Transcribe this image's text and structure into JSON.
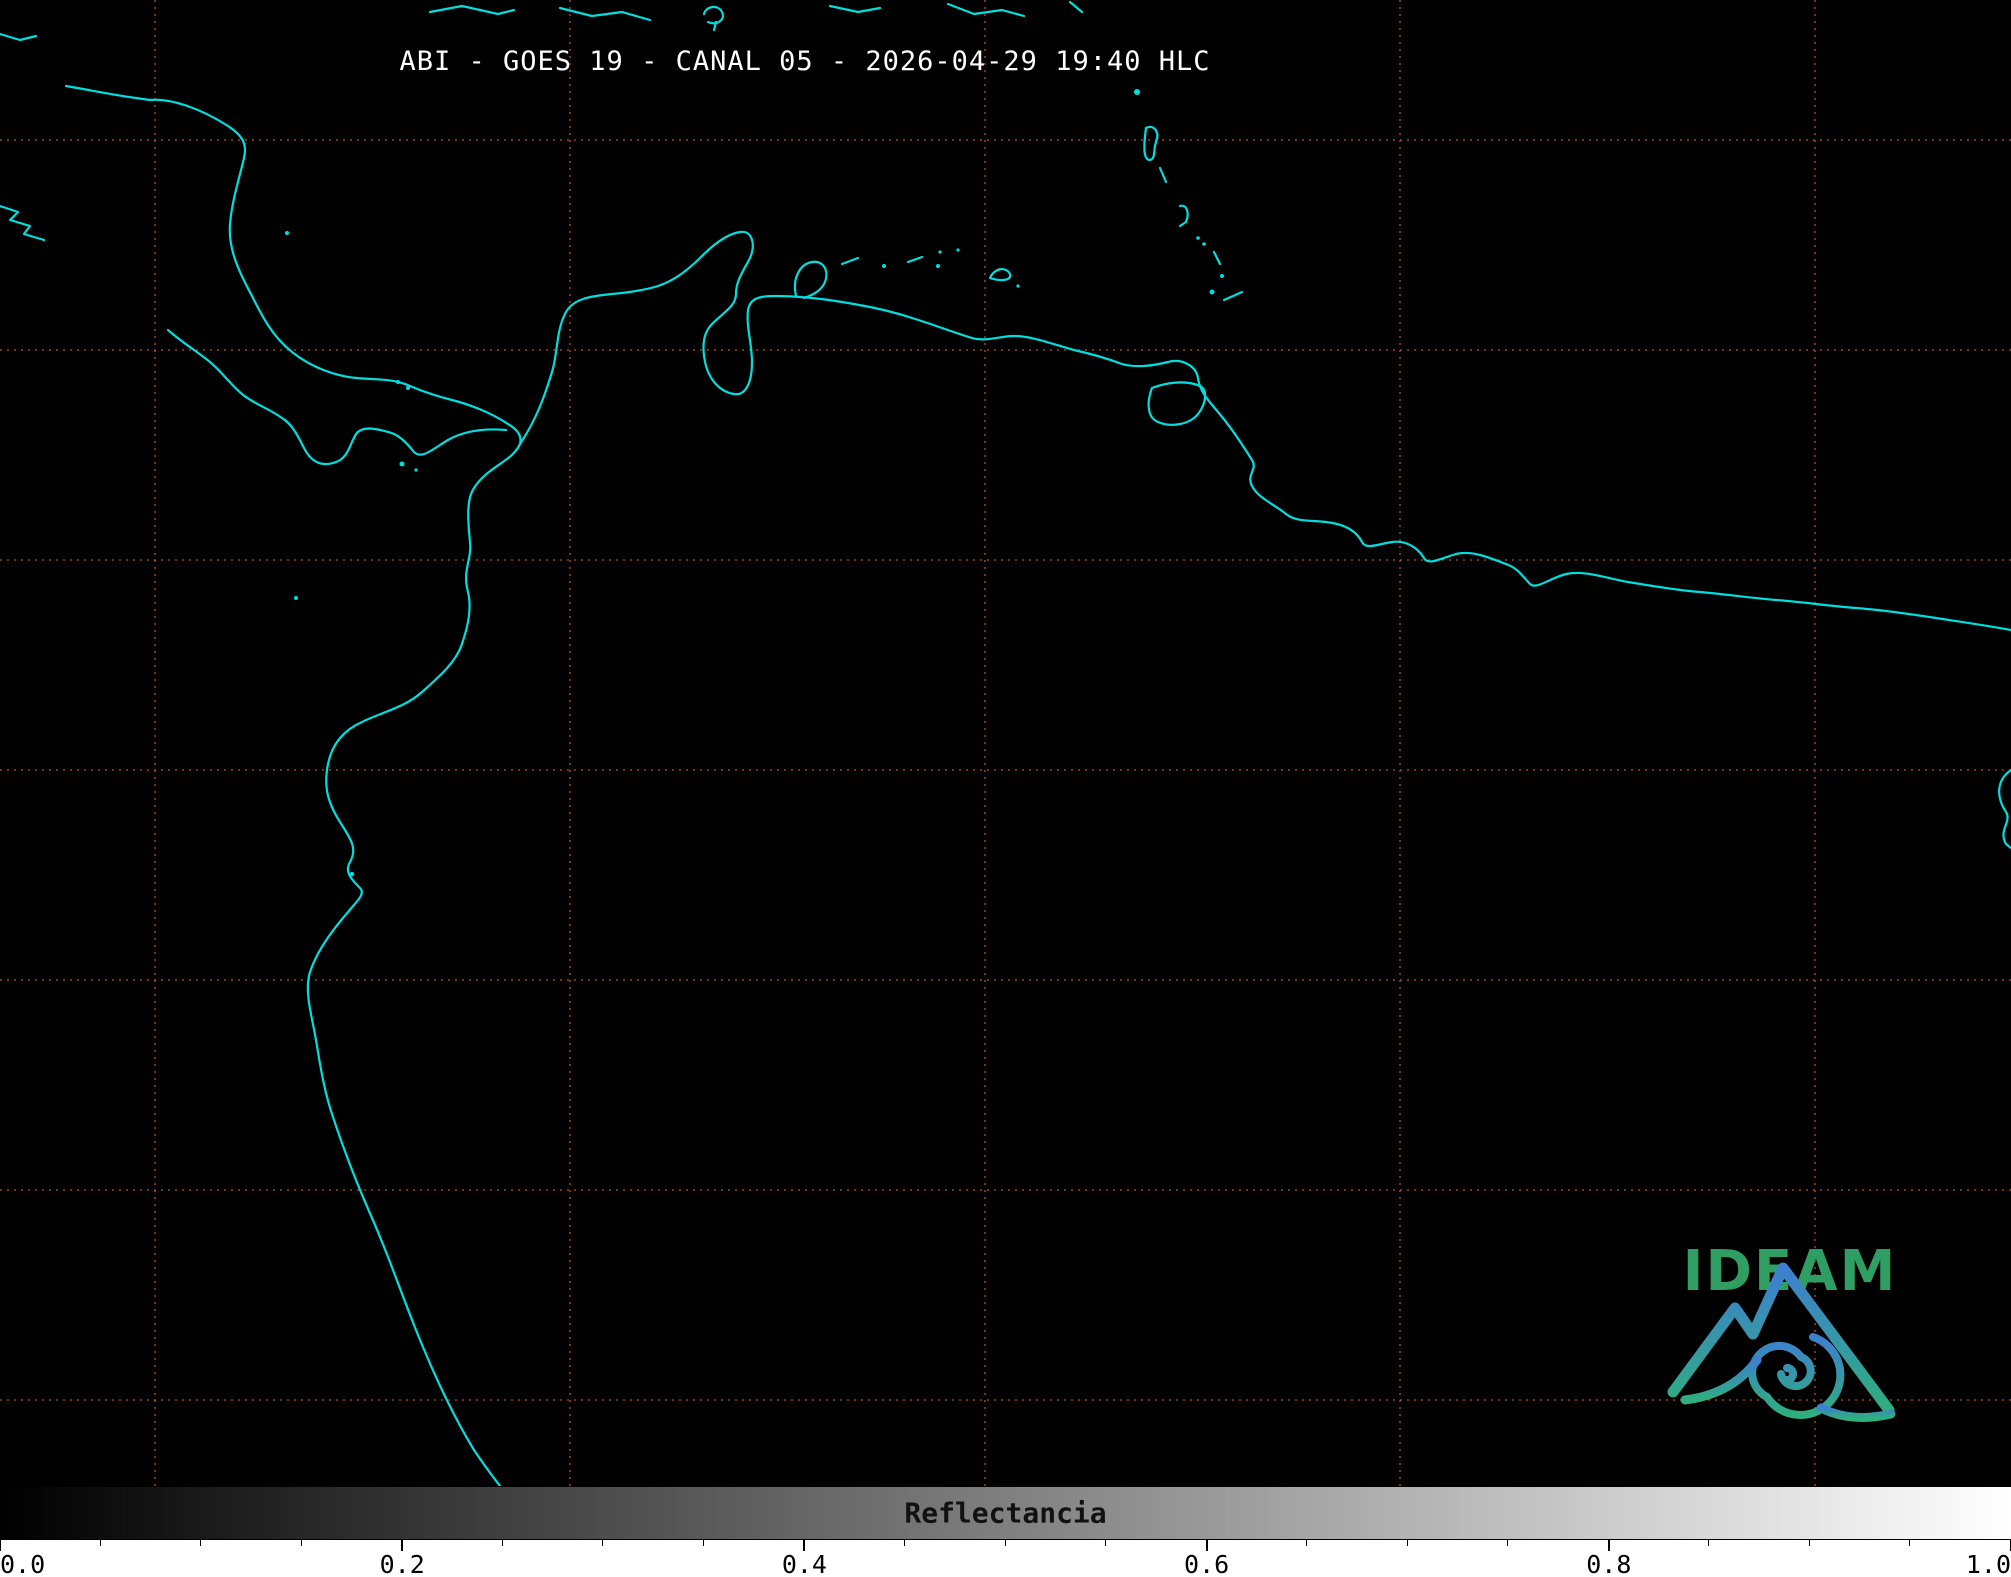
{
  "title": "ABI - GOES 19 - CANAL 05 - 2026-04-29 19:40 HLC",
  "colorbar": {
    "label": "Reflectancia",
    "ticks": [
      {
        "label": "0.0",
        "value": 0
      },
      {
        "label": "0.2",
        "value": 0.2
      },
      {
        "label": "0.4",
        "value": 0.4
      },
      {
        "label": "0.6",
        "value": 0.6
      },
      {
        "label": "0.8",
        "value": 0.8
      },
      {
        "label": "1.0",
        "value": 1
      }
    ],
    "minor_step": 0.05,
    "gradient_start": "#000000",
    "gradient_end": "#ffffff"
  },
  "logo": {
    "text": "IDEAM"
  },
  "colors": {
    "background": "#000000",
    "coastline": "#00dfdf",
    "grid": "#c4571c",
    "title_text": "#ffffff",
    "tick_text": "#000000",
    "logo_green": "#2f9e62",
    "logo_blue": "#3d7fd0"
  }
}
